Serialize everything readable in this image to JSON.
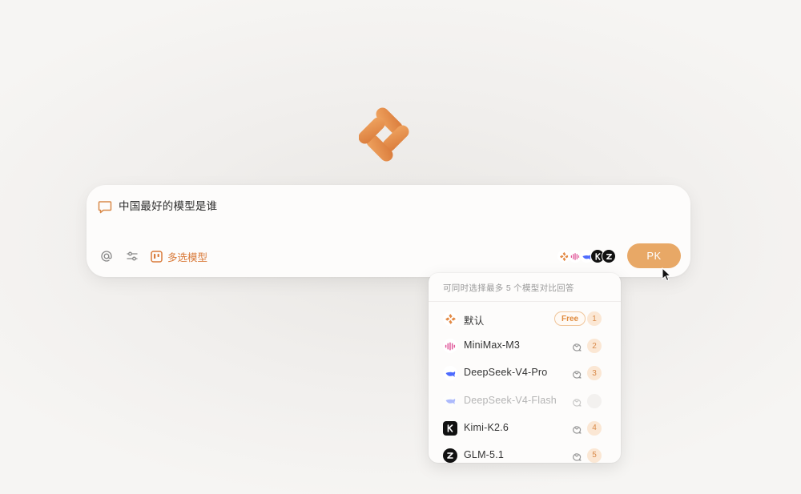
{
  "query": {
    "text": "中国最好的模型是谁"
  },
  "toolbar": {
    "multi_select_label": "多选模型",
    "pk_label": "PK"
  },
  "dropdown": {
    "hint": "可同时选择最多 5 个模型对比回答",
    "models": [
      {
        "name": "默认",
        "badge": "Free",
        "order": "1",
        "icon": "logo-icon"
      },
      {
        "name": "MiniMax-M3",
        "order": "2",
        "icon": "minimax-icon"
      },
      {
        "name": "DeepSeek-V4-Pro",
        "order": "3",
        "icon": "deepseek-icon"
      },
      {
        "name": "DeepSeek-V4-Flash",
        "order": "",
        "icon": "deepseek-icon"
      },
      {
        "name": "Kimi-K2.6",
        "order": "4",
        "icon": "kimi-icon"
      },
      {
        "name": "GLM-5.1",
        "order": "5",
        "icon": "zhipu-icon"
      }
    ]
  },
  "colors": {
    "accent": "#e8a866",
    "accent_text": "#d97a3a",
    "badge_bg": "#fbe7d4"
  }
}
